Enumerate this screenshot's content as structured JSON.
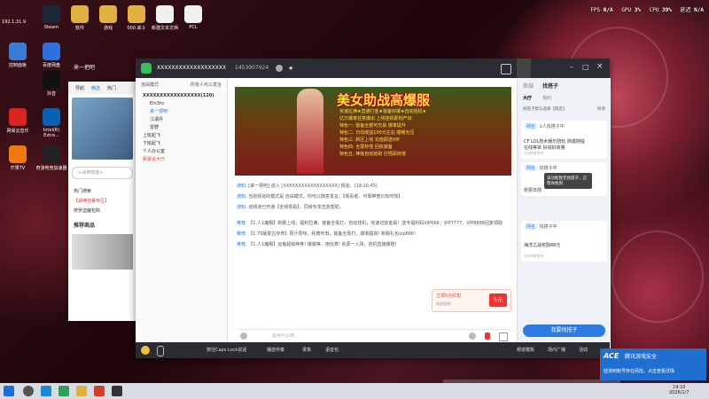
{
  "perf": {
    "fps_label": "FPS",
    "fps": "N/A",
    "gpu_label": "GPU",
    "gpu": "3%",
    "cpu_label": "CPU",
    "cpu": "39%",
    "latency_label": "延迟",
    "latency": "N/A"
  },
  "desktop": {
    "icons": [
      {
        "label": "Steam",
        "icon": "steam-icon",
        "color": "#1b2838"
      },
      {
        "label": "软件",
        "icon": "folder-icon",
        "color": "#e0b040"
      },
      {
        "label": "游戏",
        "icon": "folder-icon",
        "color": "#e0b040"
      },
      {
        "label": "000.来斗",
        "icon": "folder-icon",
        "color": "#e0b040"
      },
      {
        "label": "新建文本文档",
        "icon": "document-icon",
        "color": "#f0f0f0"
      },
      {
        "label": "PCL",
        "icon": "document-icon",
        "color": "#f0f0f0"
      },
      {
        "label": "控制面板",
        "icon": "control-panel-icon",
        "color": "#3a7bd5"
      },
      {
        "label": "百度网盘",
        "icon": "baidu-netdisk-icon",
        "color": "#2f6fe0"
      },
      {
        "label": "抖音",
        "icon": "douyin-icon",
        "color": "#111111"
      },
      {
        "label": "网易云音乐",
        "icon": "netease-music-icon",
        "color": "#d22"
      },
      {
        "label": "Intel(R) Extre...",
        "icon": "intel-icon",
        "color": "#0a5fb0"
      },
      {
        "label": "芒果TV",
        "icon": "mango-tv-icon",
        "color": "#f07a10"
      },
      {
        "label": "奇游电竞加速器",
        "icon": "accelerator-icon",
        "color": "#222"
      }
    ],
    "ip_text": "192.1.31.9"
  },
  "browser": {
    "tabs": [
      "导航",
      "精选",
      "热门"
    ],
    "search_placeholder": "+战神技能+",
    "hot_label": "热门搜索",
    "hot_item": "【战神狂暴专区】",
    "link2": "修罗迫魔包购",
    "recommend": "推荐商品"
  },
  "yy": {
    "channel_name": "XXXXXXXXXXXXXXXXXXX",
    "channel_id": "1453907924",
    "user": "来一把吧",
    "list_header_left": "自由模式",
    "list_header_right": "所有人可以发言",
    "tree": [
      {
        "label": "XXXXXXXXXXXXXXXXX(120)",
        "bold": true
      },
      {
        "label": "Ein3ro"
      },
      {
        "label": "来一把吧"
      },
      {
        "label": "江湖月"
      },
      {
        "label": "冒野"
      },
      {
        "label": "上班起飞"
      },
      {
        "label": "下班起飞"
      },
      {
        "label": "个人办公室"
      },
      {
        "label": "新歌会大厅"
      }
    ],
    "banner": {
      "title": "美女助战高爆服",
      "lines": [
        "攻速拉满★直通打金★装备好爆★自动挂机★",
        "亿万爆率任意爆出 上线挂机即刻产出",
        "特色一: 装备全部可交易 爆率提升",
        "特色二: 日均收益100元左右 顺畅无压",
        "特色三: 新区上线 充值即送VIP",
        "特色四: 全屏秒怪 回收装备",
        "特色五: 神装自动拾取 打怪即掉落"
      ]
    },
    "messages": [
      {
        "tag": "通知:",
        "text": "[来一把吧] 进入 [XXXXXXXXXXXXXXXXXX] 频道。(19:10:45)"
      },
      {
        "tag": "通知:",
        "text": "当前频道的模式是 自由模式，你可以随意发言。【观看者、可靠带宽只有时效】"
      },
      {
        "tag": "通知:",
        "text": "该频道已开通【全频观看】，同城专享志愿帮助。"
      },
      {
        "tag": "推荐:",
        "text": "【1.人1魔服】新服上线，福利拉满，装备全靠打，自动挂机，攻速切割金属！送专福利码VIP666、VIP7777、VIP8888回复领取"
      },
      {
        "tag": "推荐:",
        "text": "【1.76版复古传奇】原汁原味，经典怀旧，装备全靠打，爆率超高! 新服礼包vip666!"
      },
      {
        "tag": "推荐:",
        "text": "【1.人1魔服】运鬼超级神券! 爆装等，用信表! 资源一入场，挂机直接爆橙!"
      }
    ],
    "promo_text": "立领5元红包",
    "promo_sub": "极速到账!",
    "promo_badge": "5元",
    "input_placeholder": "说点什么吧...",
    "right": {
      "tabs": [
        "商城",
        "找搭子"
      ],
      "subtabs": [
        "大厅",
        "我的"
      ],
      "filter": "找搭子默认选择【网友】",
      "filter_btn": "修改",
      "card1_user": "网名",
      "card1_pill": "1人找搭子中",
      "card1_game": "CF LOL技术娱乐陪玩 随邀随提",
      "card1_line2": "在线等单 好说好商量",
      "card1_time": "1分钟前发布",
      "card2_user": "网名",
      "card2_pill": "找搭子中",
      "card2_game": "抢票日前",
      "tooltip": "该功能暂无找搭子，已帮你找到",
      "card3_user": "网名",
      "card3_pill": "找搭子中",
      "card3_game": "海洋之战奖励88元",
      "card3_time": "2分钟前发布",
      "cta": "我要找搭子"
    },
    "bottom": [
      "按住Caps Lock说话",
      "播放伴奏",
      "录像",
      "语音包"
    ],
    "bottom_right": [
      "频道模板",
      "场内广播",
      "活动"
    ]
  },
  "notification": {
    "title": "腾讯游戏安全",
    "body": "检测到账号存在风险，点击查看详情"
  },
  "taskbar": {
    "time": "19:10",
    "date": "2026/1/7"
  }
}
